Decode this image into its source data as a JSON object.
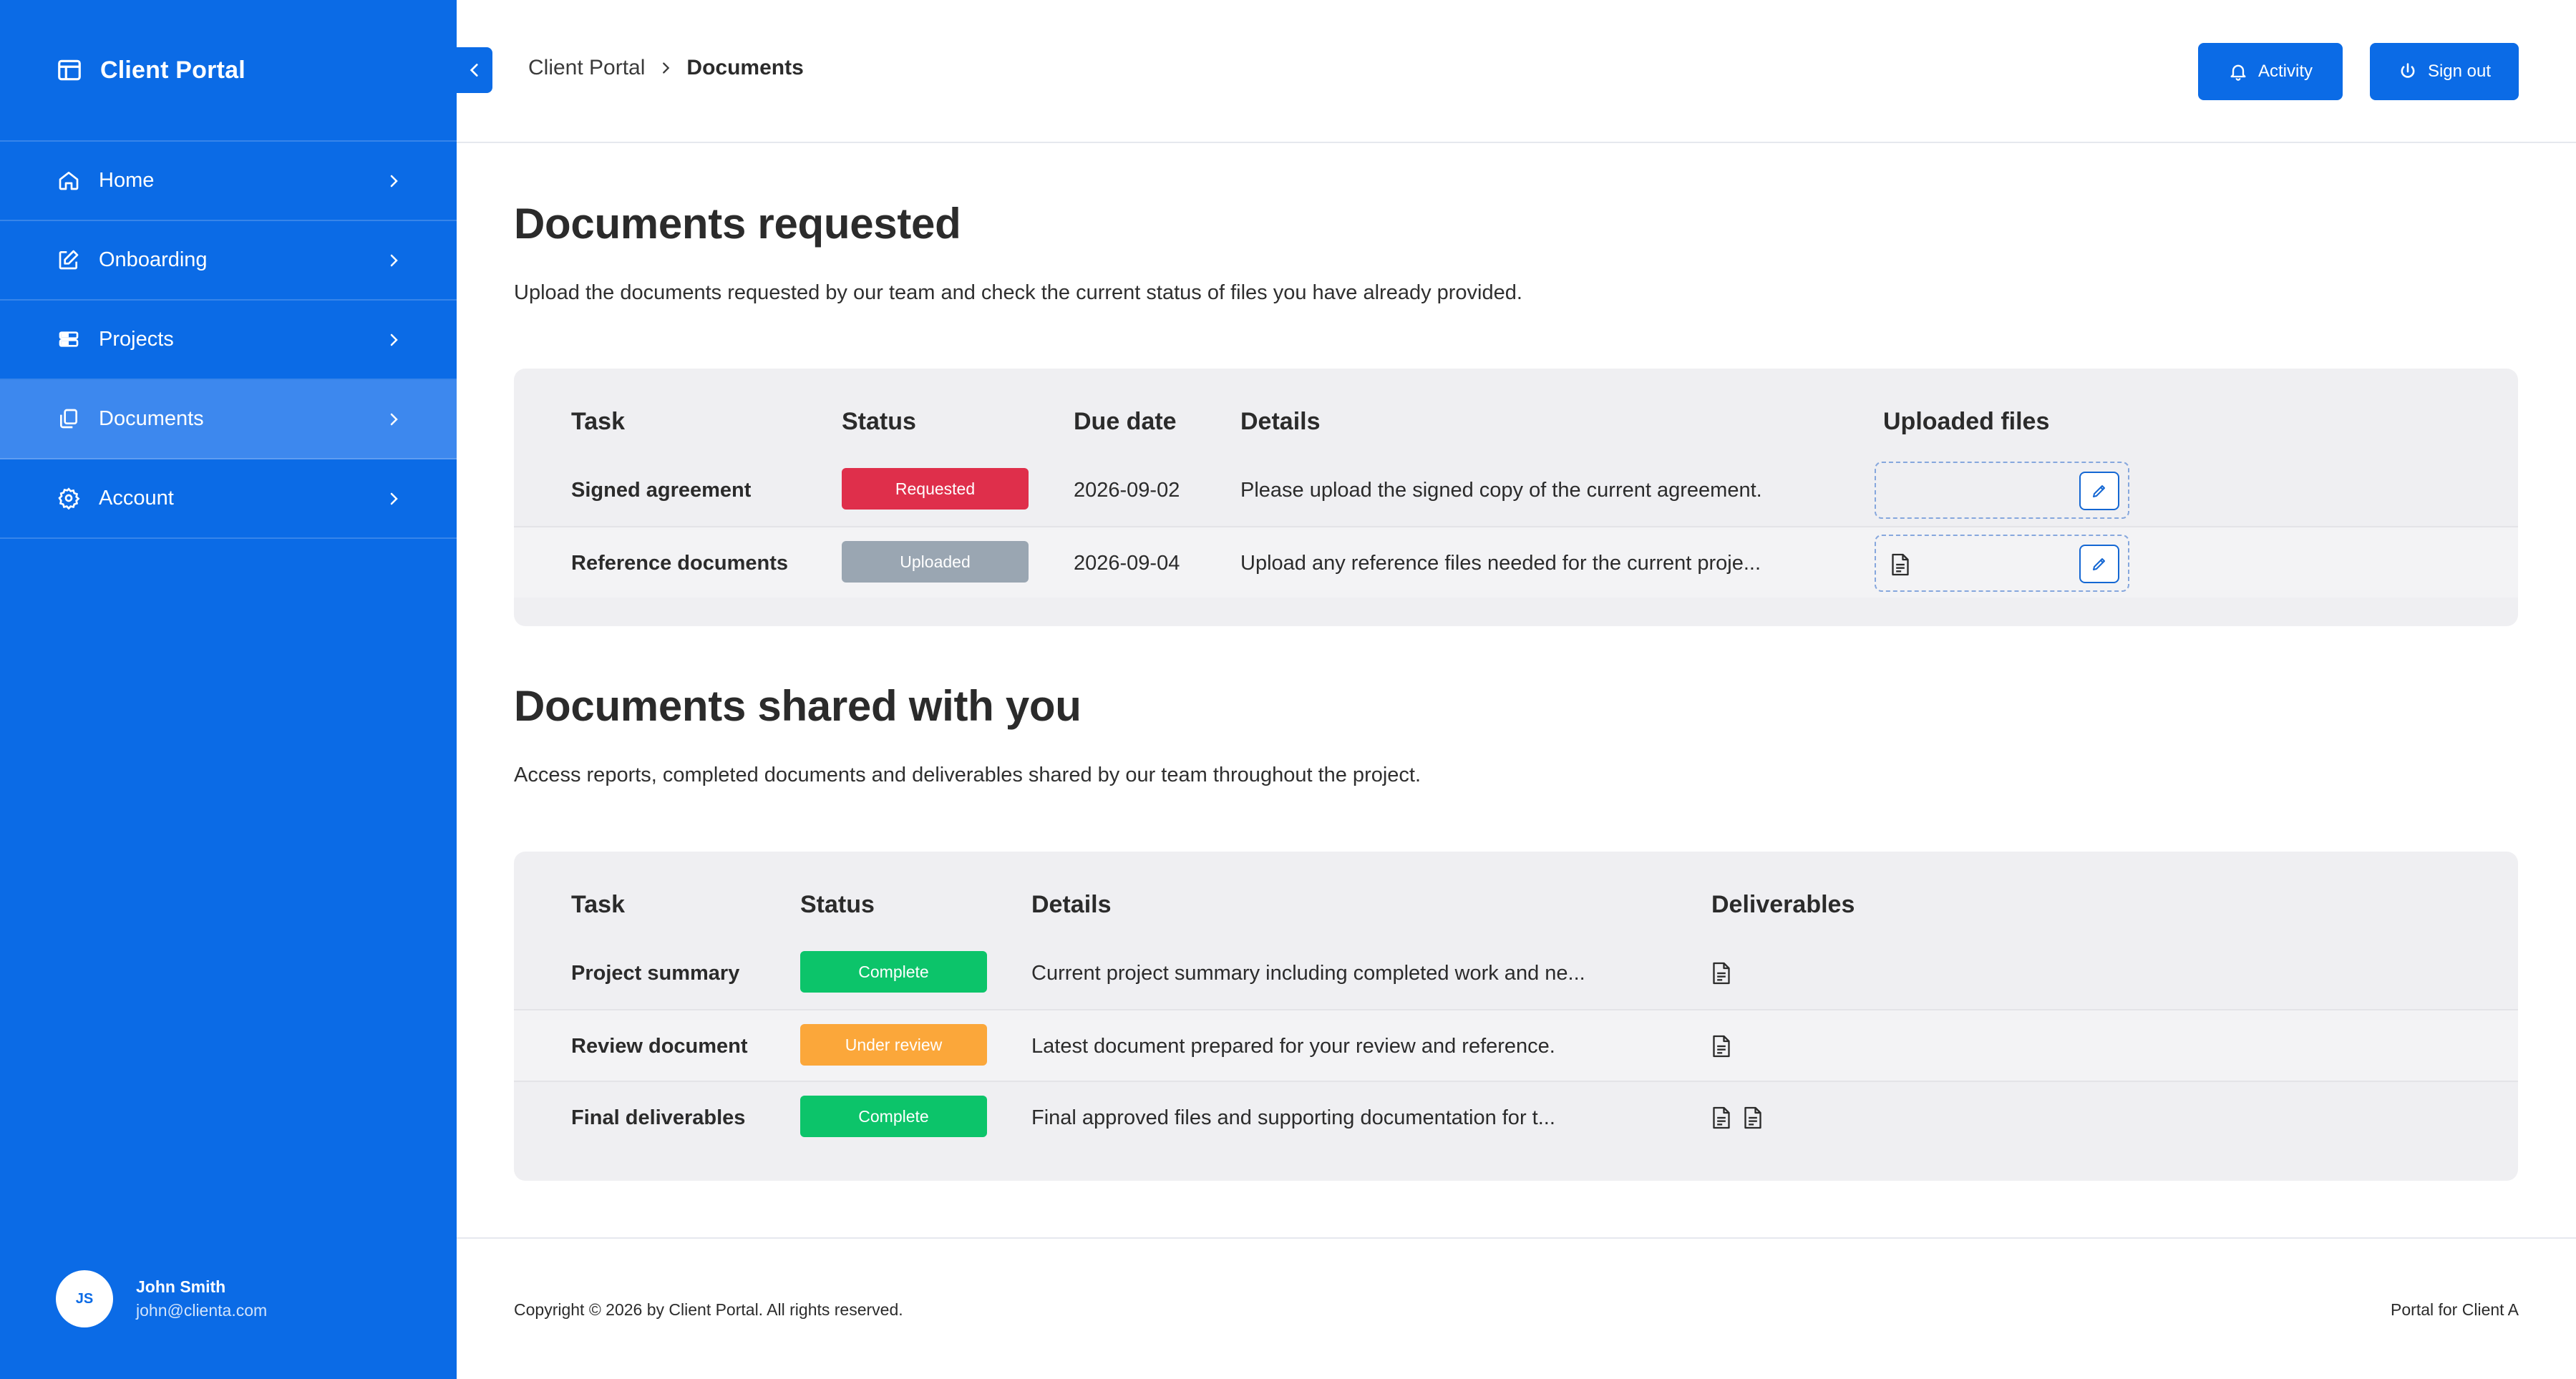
{
  "app": {
    "title": "Client Portal"
  },
  "sidebar": {
    "items": [
      {
        "label": "Home",
        "icon": "home-icon"
      },
      {
        "label": "Onboarding",
        "icon": "edit-icon"
      },
      {
        "label": "Projects",
        "icon": "server-icon"
      },
      {
        "label": "Documents",
        "icon": "copy-icon",
        "active": true
      },
      {
        "label": "Account",
        "icon": "gear-icon"
      }
    ],
    "user": {
      "initials": "JS",
      "name": "John Smith",
      "email": "john@clienta.com"
    }
  },
  "header": {
    "breadcrumb": {
      "parent": "Client Portal",
      "current": "Documents"
    },
    "activity_label": "Activity",
    "signout_label": "Sign out"
  },
  "requested": {
    "title": "Documents requested",
    "description": "Upload the documents requested by our team and check the current status of files you have already provided.",
    "columns": {
      "task": "Task",
      "status": "Status",
      "due": "Due date",
      "details": "Details",
      "files": "Uploaded files"
    },
    "rows": [
      {
        "task": "Signed agreement",
        "status": "Requested",
        "due": "2026-09-02",
        "details": "Please upload the signed copy of the current agreement.",
        "files": 0
      },
      {
        "task": "Reference documents",
        "status": "Uploaded",
        "due": "2026-09-04",
        "details": "Upload any reference files needed for the current proje...",
        "files": 1
      }
    ]
  },
  "shared": {
    "title": "Documents shared with you",
    "description": "Access reports, completed documents and deliverables shared by our team throughout the project.",
    "columns": {
      "task": "Task",
      "status": "Status",
      "details": "Details",
      "deliverables": "Deliverables"
    },
    "rows": [
      {
        "task": "Project summary",
        "status": "Complete",
        "details": "Current project summary including completed work and ne...",
        "files": 1
      },
      {
        "task": "Review document",
        "status": "Under review",
        "details": "Latest document prepared for your review and reference.",
        "files": 1
      },
      {
        "task": "Final deliverables",
        "status": "Complete",
        "details": "Final approved files and supporting documentation for t...",
        "files": 2
      }
    ]
  },
  "footer": {
    "copyright": "Copyright © 2026 by Client Portal. All rights reserved.",
    "right": "Portal for Client A"
  },
  "colors": {
    "primary": "#0b6be6",
    "requested": "#df2f4b",
    "uploaded": "#9aa6b2",
    "complete": "#0cc46a",
    "under_review": "#fba73a"
  }
}
